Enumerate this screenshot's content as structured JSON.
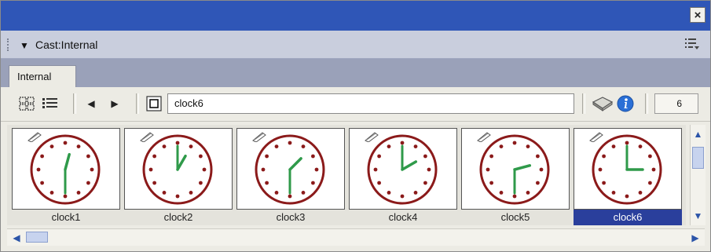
{
  "window": {
    "close_glyph": "×"
  },
  "panel": {
    "title": "Cast:Internal",
    "collapse_icon": "triangle-down-icon",
    "options_icon": "panel-options-icon"
  },
  "tabs": [
    {
      "label": "Internal",
      "active": true
    }
  ],
  "toolbar": {
    "view_icons": [
      "thumbnail-view-icon",
      "list-view-icon"
    ],
    "nav_icons": [
      "previous-arrow-icon",
      "next-arrow-icon"
    ],
    "member_type_icon": "bitmap-member-icon",
    "member_name": "clock6",
    "tool_icons": [
      "script-icon",
      "info-icon"
    ],
    "member_number": "6"
  },
  "cast_members": [
    {
      "label": "clock1",
      "selected": false,
      "hour": 12,
      "minute": 30
    },
    {
      "label": "clock2",
      "selected": false,
      "hour": 1,
      "minute": 0
    },
    {
      "label": "clock3",
      "selected": false,
      "hour": 1,
      "minute": 30
    },
    {
      "label": "clock4",
      "selected": false,
      "hour": 2,
      "minute": 0
    },
    {
      "label": "clock5",
      "selected": false,
      "hour": 2,
      "minute": 30
    },
    {
      "label": "clock6",
      "selected": true,
      "hour": 3,
      "minute": 0
    }
  ],
  "colors": {
    "titlebar": "#2f56b7",
    "clock_face": "#8b1a1a",
    "clock_hands": "#2f9a4a",
    "selection": "#2a3f9c"
  }
}
